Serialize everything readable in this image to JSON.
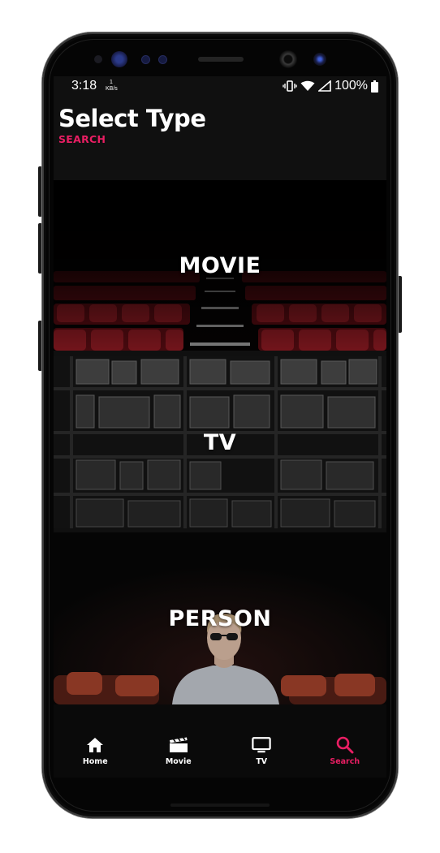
{
  "status_bar": {
    "time": "3:18",
    "net_speed_value": "1",
    "net_speed_unit": "KB/s",
    "battery_percent": "100%"
  },
  "header": {
    "title": "Select Type",
    "subtitle": "SEARCH"
  },
  "cards": [
    {
      "label": "MOVIE",
      "image": "cinema-seats"
    },
    {
      "label": "TV",
      "image": "wall-of-televisions"
    },
    {
      "label": "PERSON",
      "image": "person-in-theater"
    }
  ],
  "bottom_nav": {
    "items": [
      {
        "label": "Home",
        "icon": "home-icon",
        "active": false
      },
      {
        "label": "Movie",
        "icon": "clapperboard-icon",
        "active": false
      },
      {
        "label": "TV",
        "icon": "tv-icon",
        "active": false
      },
      {
        "label": "Search",
        "icon": "search-icon",
        "active": true
      }
    ]
  },
  "colors": {
    "accent": "#e91e63",
    "background": "#101010",
    "nav_background": "#0a0a0a",
    "text": "#ffffff"
  }
}
